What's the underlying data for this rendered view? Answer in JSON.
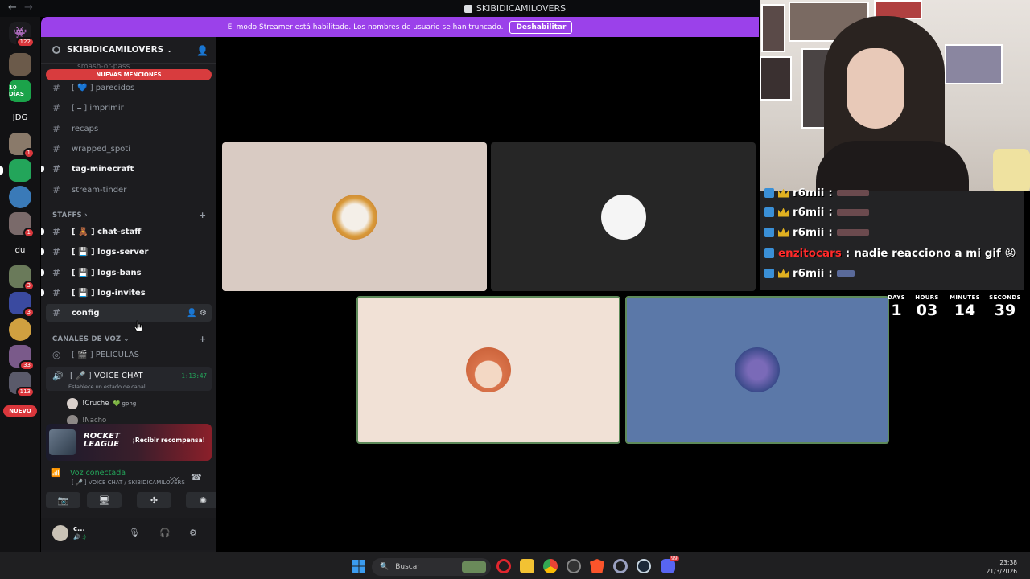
{
  "window": {
    "title": "SKIBIDICAMILOVERS"
  },
  "rail": {
    "home_badge": "122",
    "servers": [
      {
        "label": "",
        "color": "#6b5a4a",
        "badge": ""
      },
      {
        "label": "10 DÍAS",
        "color": "#1ba34a",
        "badge": ""
      },
      {
        "label": "JDG",
        "color": "#121214",
        "badge": ""
      },
      {
        "label": "",
        "color": "#8a7a6a",
        "badge": "1"
      },
      {
        "label": "",
        "color": "#23a55a",
        "badge": ""
      },
      {
        "label": "",
        "color": "#3a7ab8",
        "badge": ""
      },
      {
        "label": "",
        "color": "#7a6a6a",
        "badge": "1"
      },
      {
        "label": "du",
        "color": "#121214",
        "badge": ""
      },
      {
        "label": "",
        "color": "#6a7a5a",
        "badge": "3"
      },
      {
        "label": "",
        "color": "#3a4aa0",
        "badge": "3"
      },
      {
        "label": "",
        "color": "#d0a040",
        "badge": ""
      },
      {
        "label": "",
        "color": "#7a5a8a",
        "badge": "33"
      },
      {
        "label": "",
        "color": "#5a5a6a",
        "badge": "113"
      }
    ],
    "new_label": "NUEVO"
  },
  "banner": {
    "text": "El modo Streamer está habilitado. Los nombres de usuario se han truncado.",
    "button": "Deshabilitar"
  },
  "sidebar": {
    "guild_name": "SKIBIDICAMILOVERS",
    "new_mentions": "NUEVAS MENCIONES",
    "cut_channel": "smash-or-pass",
    "channels": [
      {
        "name": "[ 💙 ] parecidos",
        "bold": false
      },
      {
        "name": "[ ⎯ ] imprimir",
        "bold": false
      },
      {
        "name": "recaps",
        "bold": false
      },
      {
        "name": "wrapped_spoti",
        "bold": false
      },
      {
        "name": "tag-minecraft",
        "bold": true
      },
      {
        "name": "stream-tinder",
        "bold": false
      }
    ],
    "staff_category": "STAFFS",
    "staff_channels": [
      {
        "name": "[ 🧸 ] chat-staff"
      },
      {
        "name": "[ 💾 ] logs-server"
      },
      {
        "name": "[ 💾 ] logs-bans"
      },
      {
        "name": "[ 💾 ] log-invites"
      },
      {
        "name": "config"
      }
    ],
    "voice_category": "CANALES DE VOZ",
    "voice_channels": {
      "peliculas": "[ 🎬 ] PELICULAS",
      "voice_chat_tag": "[ 🎤 ]",
      "voice_chat": "VOICE CHAT",
      "time": "1:13:47",
      "status": "Establece un estado de canal"
    },
    "members": [
      {
        "name": "!Cruche",
        "sub": "💚 gpng"
      },
      {
        "name": "!Nacho",
        "sub": ""
      }
    ]
  },
  "promo": {
    "title": "ROCKET LEAGUE",
    "cta": "¡Recibir recompensa!"
  },
  "voice_panel": {
    "connected": "Voz conectada",
    "channel": "[ 🎤 ] VOICE CHAT / SKIBIDICAMILOVERS"
  },
  "user": {
    "name": "c...",
    "status": "🔊 :)"
  },
  "tiles": [
    {
      "bg": "#d9cbc3",
      "avatar": "#e2b46a"
    },
    {
      "bg": "#262626",
      "avatar": "#f0f0f0"
    },
    {
      "bg": "#f1e1d6",
      "avatar": "#d98a5a"
    },
    {
      "bg": "#5b78a8",
      "avatar": "#3a4a8a"
    }
  ],
  "chat": {
    "messages": [
      {
        "user": "r6mii",
        "text": "",
        "red": false
      },
      {
        "user": "r6mii",
        "text": "",
        "red": false
      },
      {
        "user": "r6mii",
        "text": "",
        "red": false
      },
      {
        "user": "enzitocars",
        "text": "nadie reacciono a mi gif 😡",
        "red": true
      },
      {
        "user": "r6mii",
        "text": "",
        "red": false
      }
    ]
  },
  "countdown": {
    "days_label": "DAYS",
    "days": "1",
    "hours_label": "HOURS",
    "hours": "03",
    "minutes_label": "MINUTES",
    "minutes": "14",
    "seconds_label": "SECONDS",
    "seconds": "39"
  },
  "taskbar": {
    "search": "Buscar",
    "time": "23:38",
    "date": "21/3/2026",
    "discord_badge": "99"
  }
}
